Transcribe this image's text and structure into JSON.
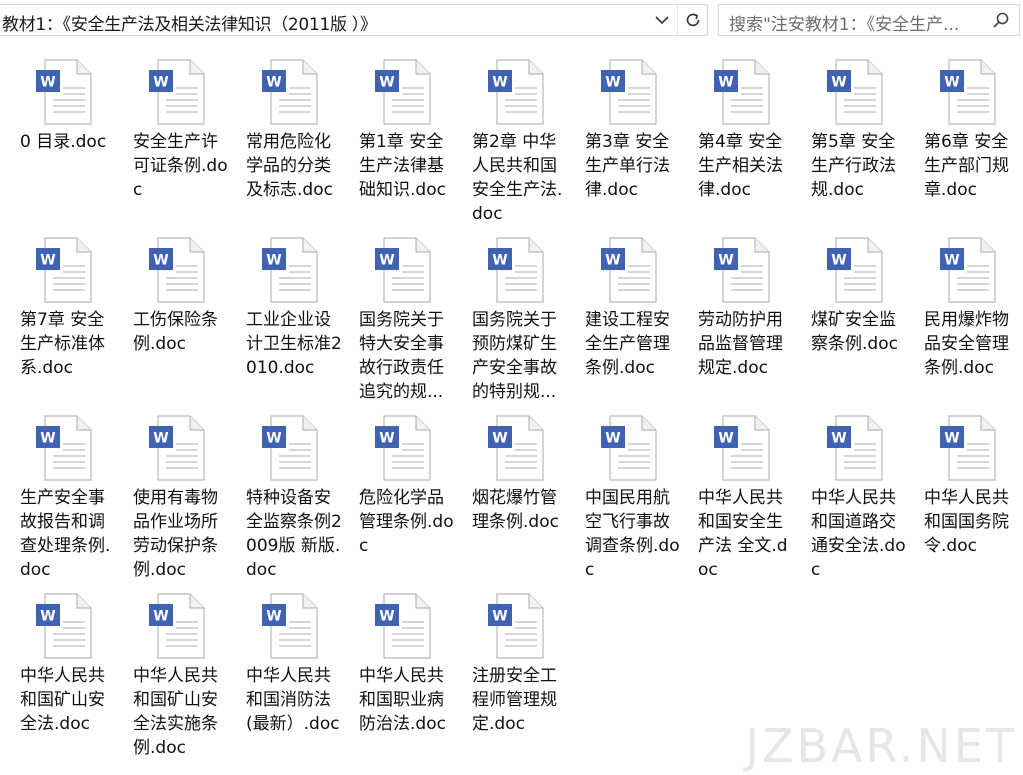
{
  "address": {
    "path": "教材1：《安全生产法及相关法律知识（2011版 ）》"
  },
  "search": {
    "placeholder": "搜索\"注安教材1：《安全生产..."
  },
  "watermark": "JZBAR.NET",
  "files": [
    {
      "name": "0 目录.doc"
    },
    {
      "name": "安全生产许可证条例.doc"
    },
    {
      "name": "常用危险化学品的分类及标志.doc"
    },
    {
      "name": "第1章 安全生产法律基础知识.doc"
    },
    {
      "name": "第2章 中华人民共和国安全生产法.doc"
    },
    {
      "name": "第3章 安全生产单行法律.doc"
    },
    {
      "name": "第4章 安全生产相关法律.doc"
    },
    {
      "name": "第5章  安全生产行政法规.doc"
    },
    {
      "name": "第6章  安全生产部门规章.doc"
    },
    {
      "name": "第7章  安全生产标准体系.doc"
    },
    {
      "name": "工伤保险条例.doc"
    },
    {
      "name": "工业企业设计卫生标准2010.doc"
    },
    {
      "name": "国务院关于特大安全事故行政责任追究的规..."
    },
    {
      "name": "国务院关于预防煤矿生产安全事故的特别规..."
    },
    {
      "name": "建设工程安全生产管理条例.doc"
    },
    {
      "name": "劳动防护用品监督管理规定.doc"
    },
    {
      "name": "煤矿安全监察条例.doc"
    },
    {
      "name": "民用爆炸物品安全管理条例.doc"
    },
    {
      "name": "生产安全事故报告和调查处理条例.doc"
    },
    {
      "name": "使用有毒物品作业场所劳动保护条例.doc"
    },
    {
      "name": "特种设备安全监察条例2009版 新版.doc"
    },
    {
      "name": "危险化学品管理条例.doc"
    },
    {
      "name": "烟花爆竹管理条例.doc"
    },
    {
      "name": "中国民用航空飞行事故调查条例.doc"
    },
    {
      "name": "中华人民共和国安全生产法 全文.doc"
    },
    {
      "name": "中华人民共和国道路交通安全法.doc"
    },
    {
      "name": "中华人民共和国国务院令.doc"
    },
    {
      "name": "中华人民共和国矿山安全法.doc"
    },
    {
      "name": "中华人民共和国矿山安全法实施条例.doc"
    },
    {
      "name": "中华人民共和国消防法(最新）.doc"
    },
    {
      "name": "中华人民共和国职业病防治法.doc"
    },
    {
      "name": "注册安全工程师管理规定.doc"
    }
  ]
}
